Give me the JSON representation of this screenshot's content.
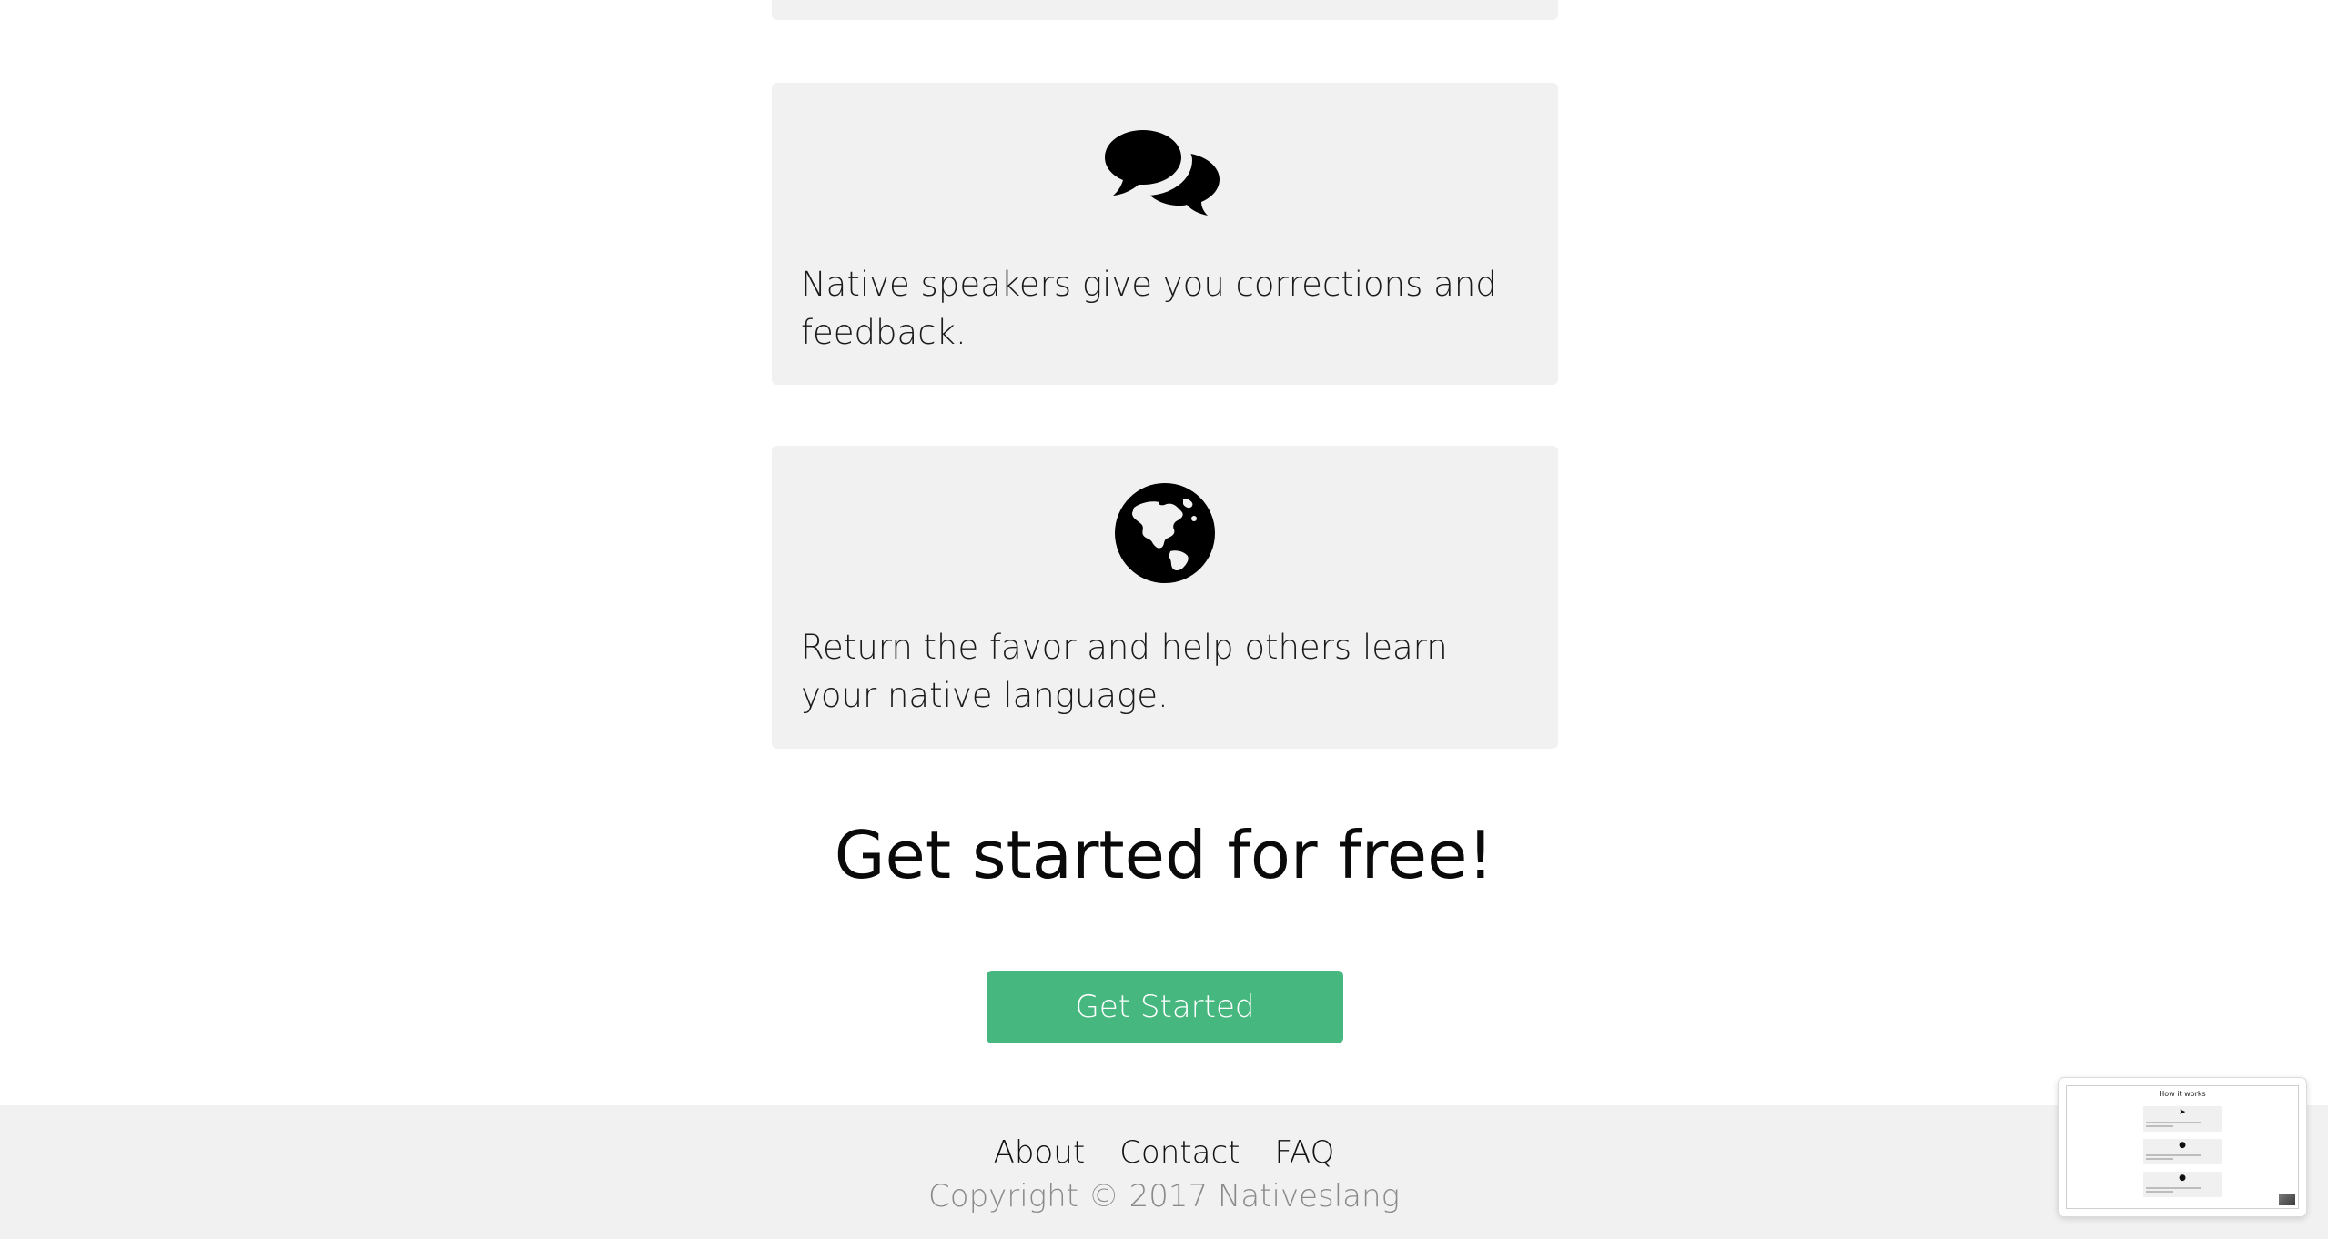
{
  "steps": [
    {
      "icon": "speech-bubbles-icon",
      "text": "Native speakers give you corrections and feedback."
    },
    {
      "icon": "globe-americas-icon",
      "text": "Return the favor and help others learn your native language."
    }
  ],
  "cta": {
    "heading": "Get started for free!",
    "button_label": "Get Started"
  },
  "footer": {
    "links": [
      "About",
      "Contact",
      "FAQ"
    ],
    "copyright": "Copyright © 2017 Nativeslang"
  },
  "preview": {
    "title": "How it works"
  },
  "colors": {
    "accent": "#46b87f",
    "card_bg": "#f1f1f1",
    "footer_bg": "#f1f1f1",
    "copyright_text": "#8a8a8a"
  }
}
